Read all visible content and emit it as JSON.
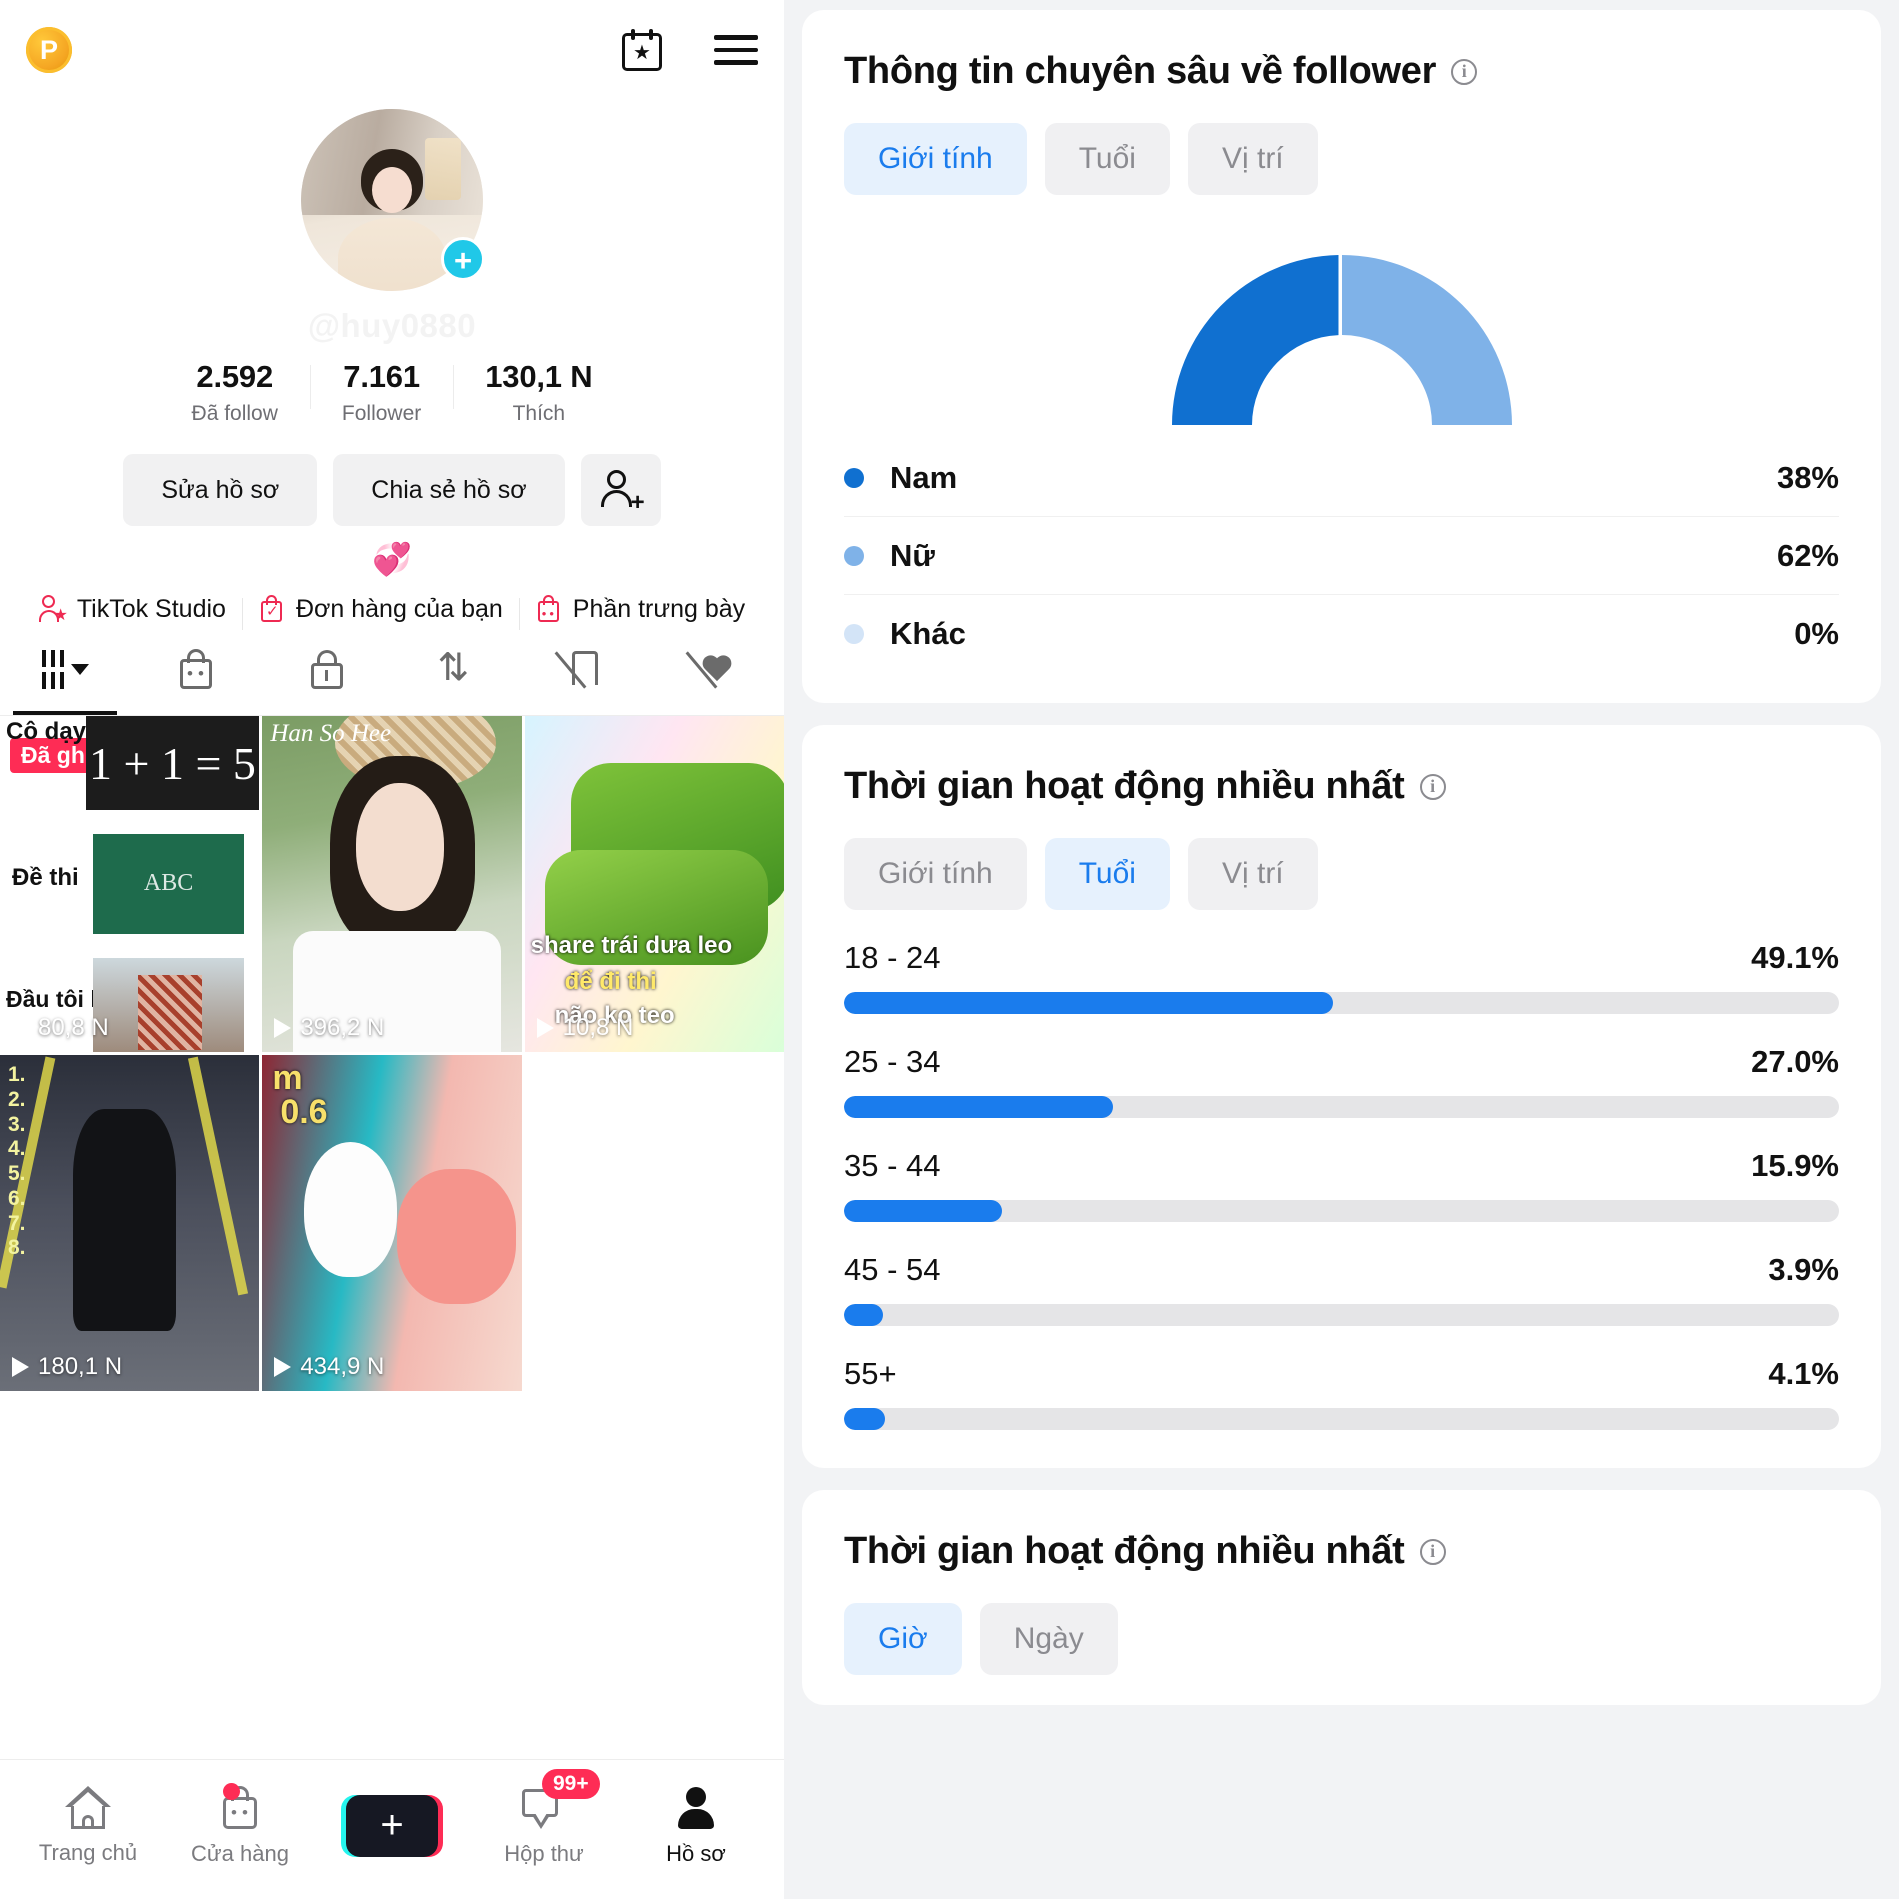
{
  "profile": {
    "coin_badge": "P",
    "calendar_icon": "calendar-star-icon",
    "menu_icon": "hamburger-menu-icon",
    "avatar_alt": "avatar",
    "add_story_icon": "plus-icon",
    "handle": "@huy0880",
    "stats": [
      {
        "num": "2.592",
        "label": "Đã follow"
      },
      {
        "num": "7.161",
        "label": "Follower"
      },
      {
        "num": "130,1 N",
        "label": "Thích"
      }
    ],
    "buttons": {
      "edit": "Sửa hồ sơ",
      "share": "Chia sẻ hồ sơ",
      "add_friend_icon": "add-user-icon"
    },
    "bio_emoji": "💞",
    "links": [
      {
        "label": "TikTok Studio",
        "icon": "studio-icon"
      },
      {
        "label": "Đơn hàng của bạn",
        "icon": "order-bag-icon"
      },
      {
        "label": "Phần trưng bày",
        "icon": "showcase-bag-icon"
      }
    ],
    "tabs": [
      {
        "icon": "grid-icon",
        "active": true
      },
      {
        "icon": "shop-bag-icon",
        "active": false
      },
      {
        "icon": "lock-icon",
        "active": false
      },
      {
        "icon": "repost-icon",
        "active": false
      },
      {
        "icon": "tag-off-icon",
        "active": false
      },
      {
        "icon": "heart-off-icon",
        "active": false
      }
    ],
    "videos": [
      {
        "views": "80,8 N",
        "pinned_label": "Đã ghim",
        "cap1": "Cô dạy",
        "cap2": "Đề thi",
        "cap3": "Đầu tôi lúc đó :",
        "board1": "1 + 1 = 5",
        "board2": "ABC"
      },
      {
        "views": "396,2 N",
        "overlay": "Han So Hee"
      },
      {
        "views": "10,8 N",
        "l1": "share trái dưa leo",
        "l2": "để đi thi",
        "l3": "não ko teo"
      },
      {
        "views": "180,1 N",
        "nums": "1.\n2.\n3.\n4.\n5.\n6.\n7.\n8."
      },
      {
        "views": "434,9 N",
        "t1": "m",
        "t2": "0.6"
      },
      {
        "views": ""
      }
    ],
    "bottom_nav": [
      {
        "label": "Trang chủ",
        "icon": "home-icon",
        "active": false,
        "badge": ""
      },
      {
        "label": "Cửa hàng",
        "icon": "shop-icon",
        "active": false,
        "badge": "dot"
      },
      {
        "label": "",
        "icon": "create-plus-icon",
        "active": false,
        "badge": ""
      },
      {
        "label": "Hộp thư",
        "icon": "inbox-icon",
        "active": false,
        "badge": "99+"
      },
      {
        "label": "Hồ sơ",
        "icon": "profile-icon",
        "active": true,
        "badge": ""
      }
    ]
  },
  "analytics": {
    "follower_card": {
      "title": "Thông tin chuyên sâu về follower",
      "info_icon": "info-icon",
      "segments": [
        {
          "label": "Giới tính",
          "active": true
        },
        {
          "label": "Tuổi",
          "active": false
        },
        {
          "label": "Vị trí",
          "active": false
        }
      ]
    },
    "age_card": {
      "title": "Thời gian hoạt động nhiều nhất",
      "info_icon": "info-icon",
      "segments": [
        {
          "label": "Giới tính",
          "active": false
        },
        {
          "label": "Tuổi",
          "active": true
        },
        {
          "label": "Vị trí",
          "active": false
        }
      ]
    },
    "time_card": {
      "title": "Thời gian hoạt động nhiều nhất",
      "info_icon": "info-icon",
      "segments": [
        {
          "label": "Giờ",
          "active": true
        },
        {
          "label": "Ngày",
          "active": false
        }
      ]
    },
    "colors": {
      "accent": "#1a7ced",
      "male": "#1070d0",
      "female": "#7fb2e8",
      "other": "#d3e4f7",
      "track": "#e5e5e7",
      "seg_on_bg": "#e6f1fd"
    }
  },
  "chart_data": [
    {
      "type": "pie",
      "title": "Thông tin chuyên sâu về follower",
      "subtitle": "Giới tính",
      "labels": [
        "Nam",
        "Nữ",
        "Khác"
      ],
      "values": [
        38,
        62,
        0
      ],
      "value_labels": [
        "38%",
        "62%",
        "0%"
      ],
      "colors": [
        "#1070d0",
        "#7fb2e8",
        "#d3e4f7"
      ],
      "semi_donut": true,
      "legend": "bottom-list"
    },
    {
      "type": "bar",
      "title": "Thời gian hoạt động nhiều nhất",
      "subtitle": "Tuổi",
      "orientation": "horizontal",
      "categories": [
        "18 - 24",
        "25 - 34",
        "35 - 44",
        "45 - 54",
        "55+"
      ],
      "values": [
        49.1,
        27.0,
        15.9,
        3.9,
        4.1
      ],
      "value_labels": [
        "49.1%",
        "27.0%",
        "15.9%",
        "3.9%",
        "4.1%"
      ],
      "xlabel": "",
      "ylabel": "",
      "xlim": [
        0,
        100
      ],
      "grid": false,
      "bar_color": "#1a7ced",
      "track_color": "#e5e5e7"
    }
  ]
}
